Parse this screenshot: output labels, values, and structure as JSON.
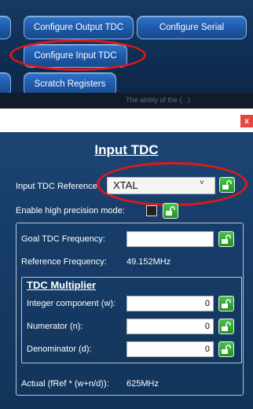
{
  "background": {
    "buttons": {
      "configure_output_tdc": "Configure Output TDC",
      "configure_serial": "Configure Serial",
      "configure_input_tdc": "Configure Input TDC",
      "scratch_registers": "Scratch Registers"
    },
    "strip_text": "The ability of  the (...)"
  },
  "dialog": {
    "close_label": "x",
    "title": "Input TDC",
    "input_tdc_reference": {
      "label": "Input TDC Reference",
      "value": "XTAL",
      "arrow": "˅"
    },
    "high_precision": {
      "label": "Enable high precision mode:",
      "checked": false
    },
    "goal_tdc_frequency": {
      "label": "Goal TDC Frequency:",
      "value": ""
    },
    "reference_frequency": {
      "label": "Reference Frequency:",
      "value": "49.152MHz"
    },
    "tdc_multiplier": {
      "title": "TDC Multiplier",
      "integer": {
        "label": "Integer component (w):",
        "value": "0"
      },
      "numerator": {
        "label": "Numerator (n):",
        "value": "0"
      },
      "denominator": {
        "label": "Denominator (d):",
        "value": "0"
      }
    },
    "actual": {
      "label": "Actual (fRef * (w+n/d)):",
      "value": "625MHz"
    }
  },
  "colors": {
    "accent_button": "#1d58a6",
    "dialog_bg": "#163c68",
    "highlight_oval": "#e01818",
    "lock_green": "#23921f"
  },
  "icons": {
    "lock": "unlock-icon"
  }
}
